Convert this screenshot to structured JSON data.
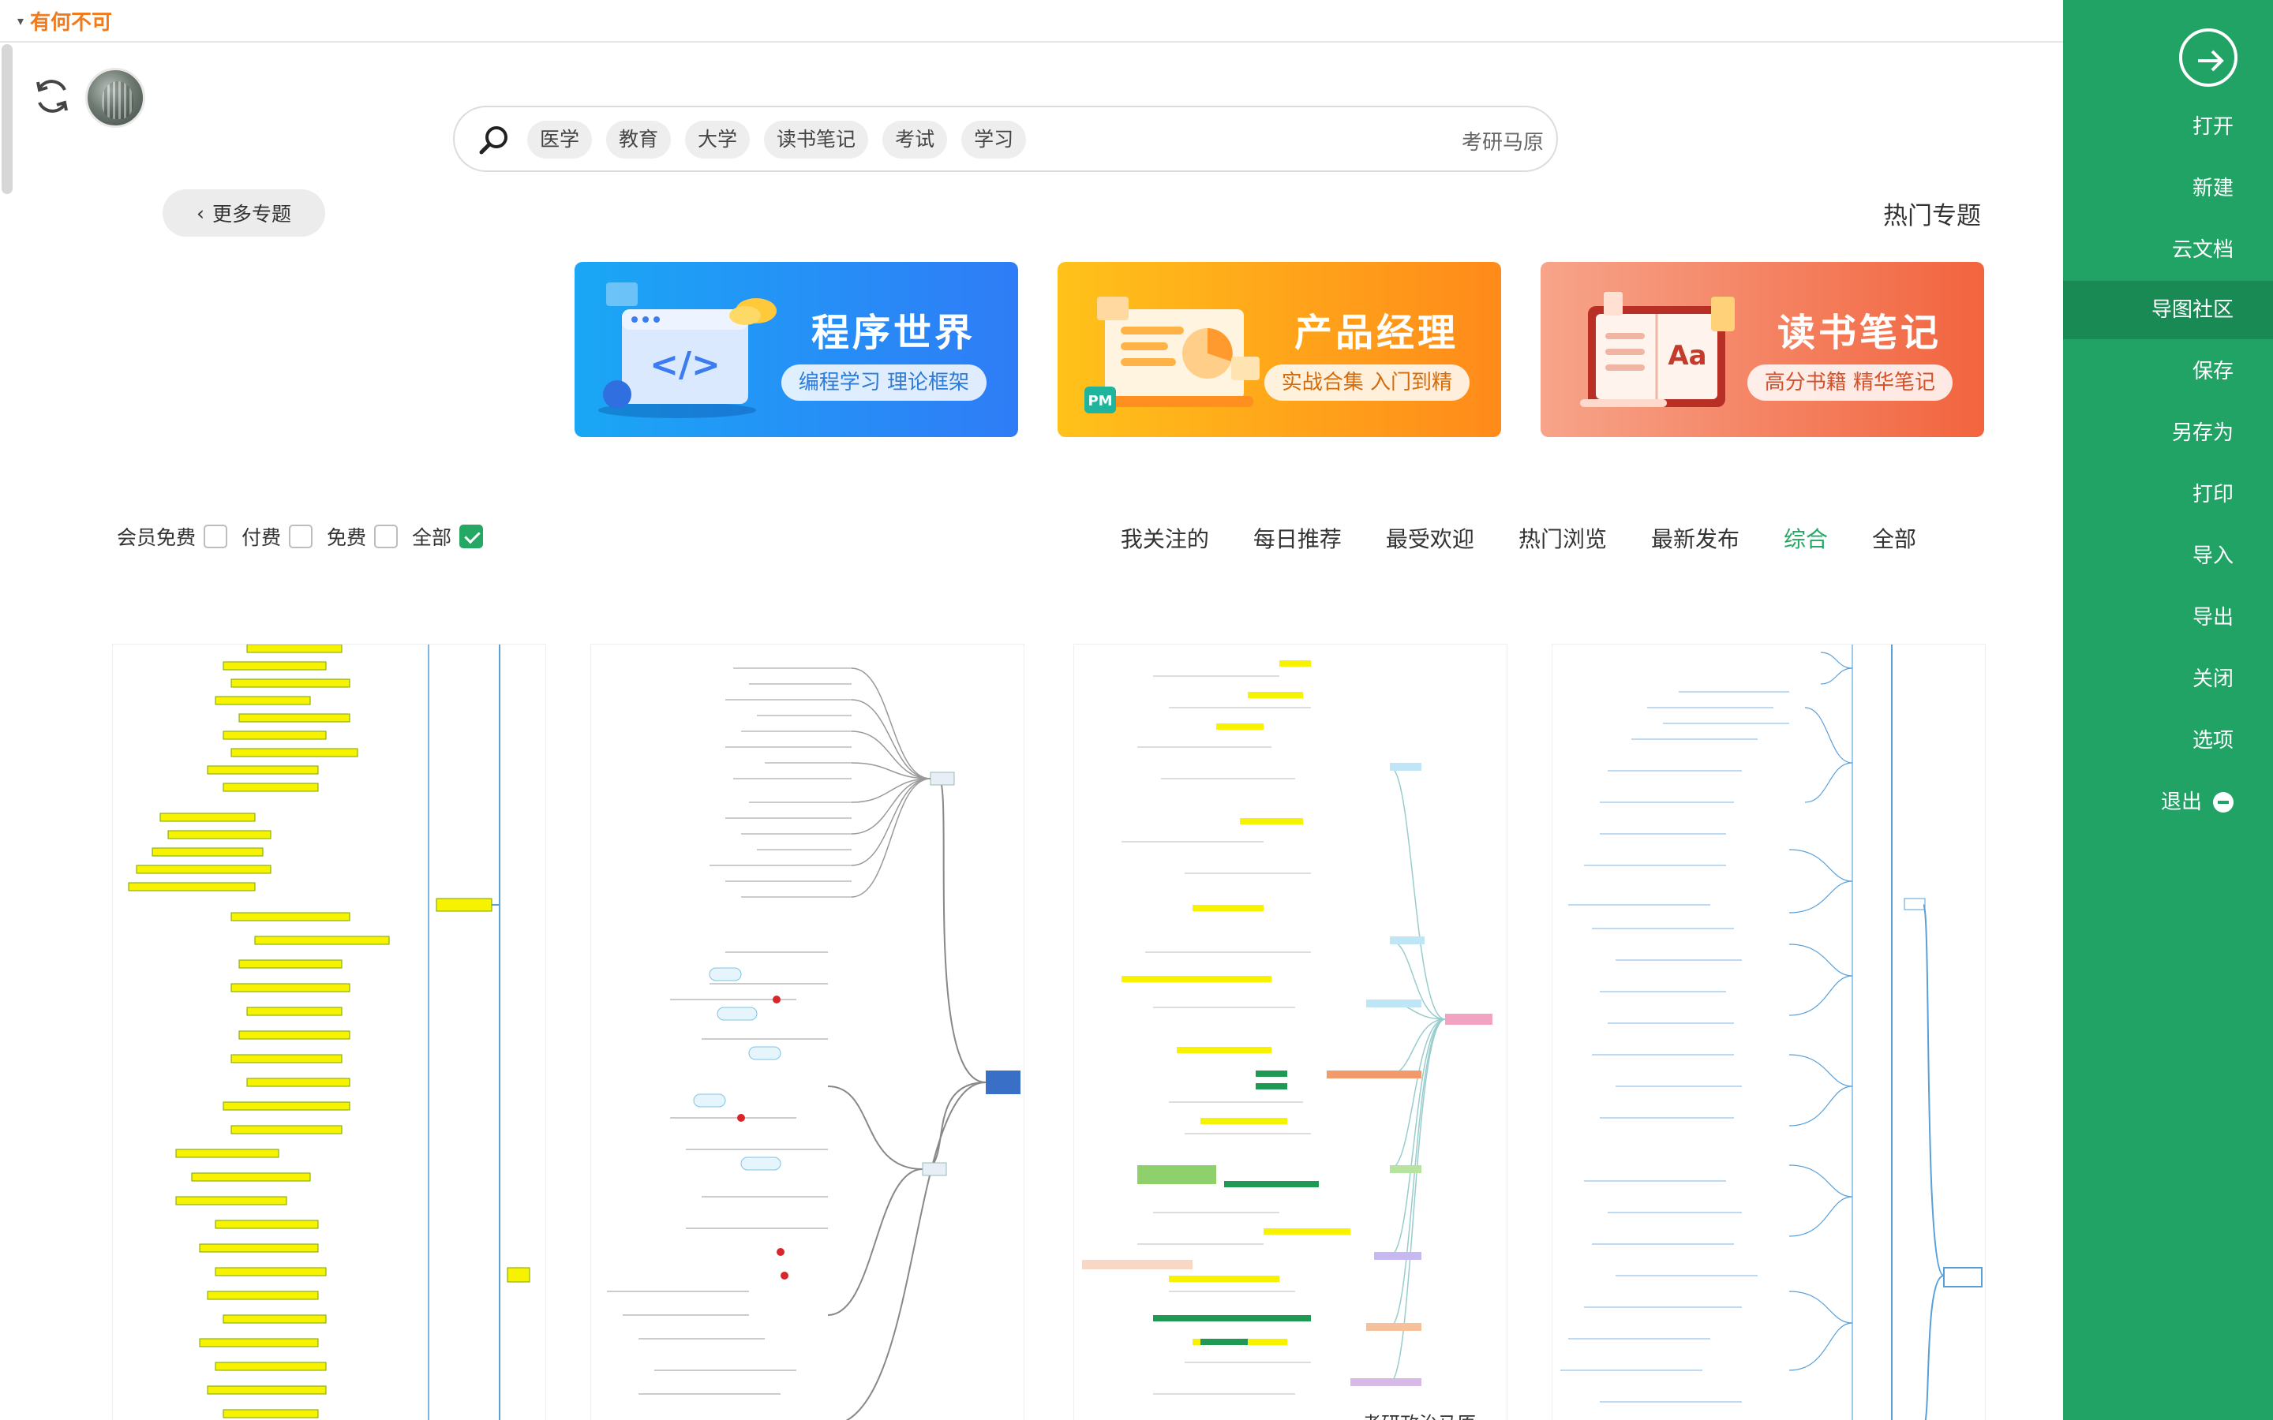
{
  "app": {
    "brand": "有何不可"
  },
  "search": {
    "placeholder": "考研马原",
    "tags": [
      "医学",
      "教育",
      "大学",
      "读书笔记",
      "考试",
      "学习"
    ]
  },
  "section": {
    "title": "热门专题",
    "more_label": "更多专题"
  },
  "banners": [
    {
      "title": "程序世界",
      "subtitle": "编程学习 理论框架",
      "icon": "code-window-icon"
    },
    {
      "title": "产品经理",
      "subtitle": "实战合集 入门到精",
      "icon": "laptop-pm-icon"
    },
    {
      "title": "读书笔记",
      "subtitle": "高分书籍 精华笔记",
      "icon": "notebook-icon"
    }
  ],
  "filters": {
    "items": [
      {
        "label": "全部",
        "checked": true
      },
      {
        "label": "免费",
        "checked": false
      },
      {
        "label": "付费",
        "checked": false
      },
      {
        "label": "会员免费",
        "checked": false
      }
    ]
  },
  "tabs": [
    {
      "label": "全部",
      "active": false
    },
    {
      "label": "综合",
      "active": true
    },
    {
      "label": "最新发布",
      "active": false
    },
    {
      "label": "热门浏览",
      "active": false
    },
    {
      "label": "最受欢迎",
      "active": false
    },
    {
      "label": "每日推荐",
      "active": false
    },
    {
      "label": "我关注的",
      "active": false
    }
  ],
  "cards": [
    {
      "style": "yellow-tree",
      "caption": ""
    },
    {
      "style": "gray-radial",
      "caption": ""
    },
    {
      "style": "colorful-dense",
      "caption": "考研政治马原"
    },
    {
      "style": "blue-tree",
      "caption": ""
    }
  ],
  "sidebar": {
    "items": [
      {
        "label": "打开",
        "active": false
      },
      {
        "label": "新建",
        "active": false
      },
      {
        "label": "云文档",
        "active": false
      },
      {
        "label": "导图社区",
        "active": true
      },
      {
        "label": "保存",
        "active": false
      },
      {
        "label": "另存为",
        "active": false
      },
      {
        "label": "打印",
        "active": false
      },
      {
        "label": "导入",
        "active": false
      },
      {
        "label": "导出",
        "active": false
      },
      {
        "label": "关闭",
        "active": false
      },
      {
        "label": "选项",
        "active": false
      }
    ],
    "exit_label": "退出"
  },
  "colors": {
    "accent": "#21a366",
    "brand": "#f07b1f"
  }
}
